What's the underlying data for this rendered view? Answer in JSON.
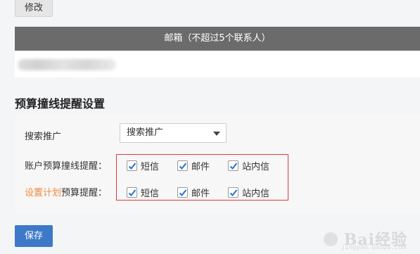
{
  "top": {
    "modify_label": "修改"
  },
  "email": {
    "header": "邮箱（不超过5个联系人）"
  },
  "budget": {
    "title": "预算撞线提醒设置",
    "channel_label": "搜索推广",
    "channel_select": "搜索推广",
    "account_label": "账户预算撞线提醒：",
    "plan_link": "设置计划",
    "plan_label_suffix": "预算提醒：",
    "options": {
      "sms": "短信",
      "email": "邮件",
      "inbox": "站内信"
    }
  },
  "footer": {
    "save_label": "保存"
  },
  "watermark": {
    "text": "Bai经验",
    "sub": "jingyan.baidu.com"
  }
}
